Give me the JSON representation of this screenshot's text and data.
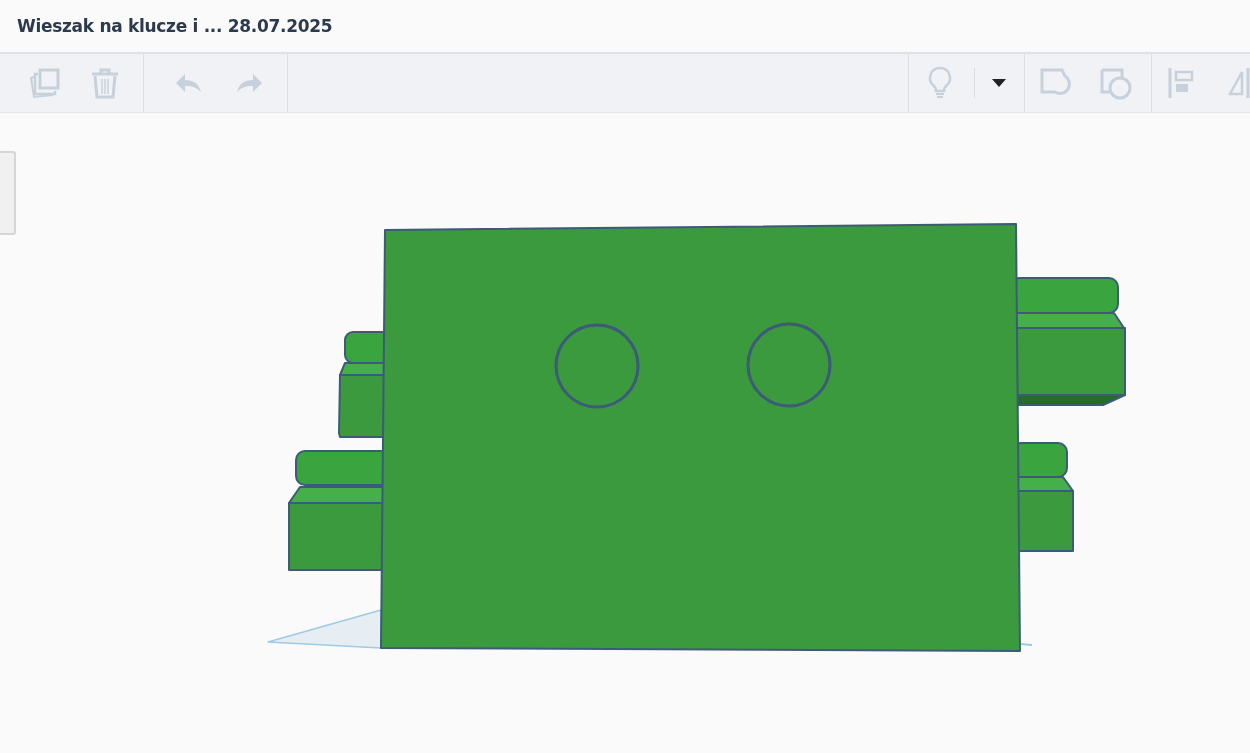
{
  "window": {
    "title": "Wieszak na klucze i ... 28.07.2025"
  },
  "toolbar": {
    "left_groups": [
      [
        {
          "kind": "duplicate",
          "disabled": true
        },
        {
          "kind": "delete",
          "disabled": true
        }
      ],
      [
        {
          "kind": "undo",
          "disabled": true
        },
        {
          "kind": "redo",
          "disabled": true
        }
      ]
    ],
    "right_groups": [
      [
        {
          "kind": "lightbulb",
          "disabled": true
        },
        {
          "kind": "dropdown",
          "disabled": false
        }
      ],
      [
        {
          "kind": "group",
          "disabled": true
        },
        {
          "kind": "subtract",
          "disabled": true
        }
      ],
      [
        {
          "kind": "align",
          "disabled": true
        },
        {
          "kind": "mirror",
          "disabled": true
        }
      ]
    ]
  }
}
